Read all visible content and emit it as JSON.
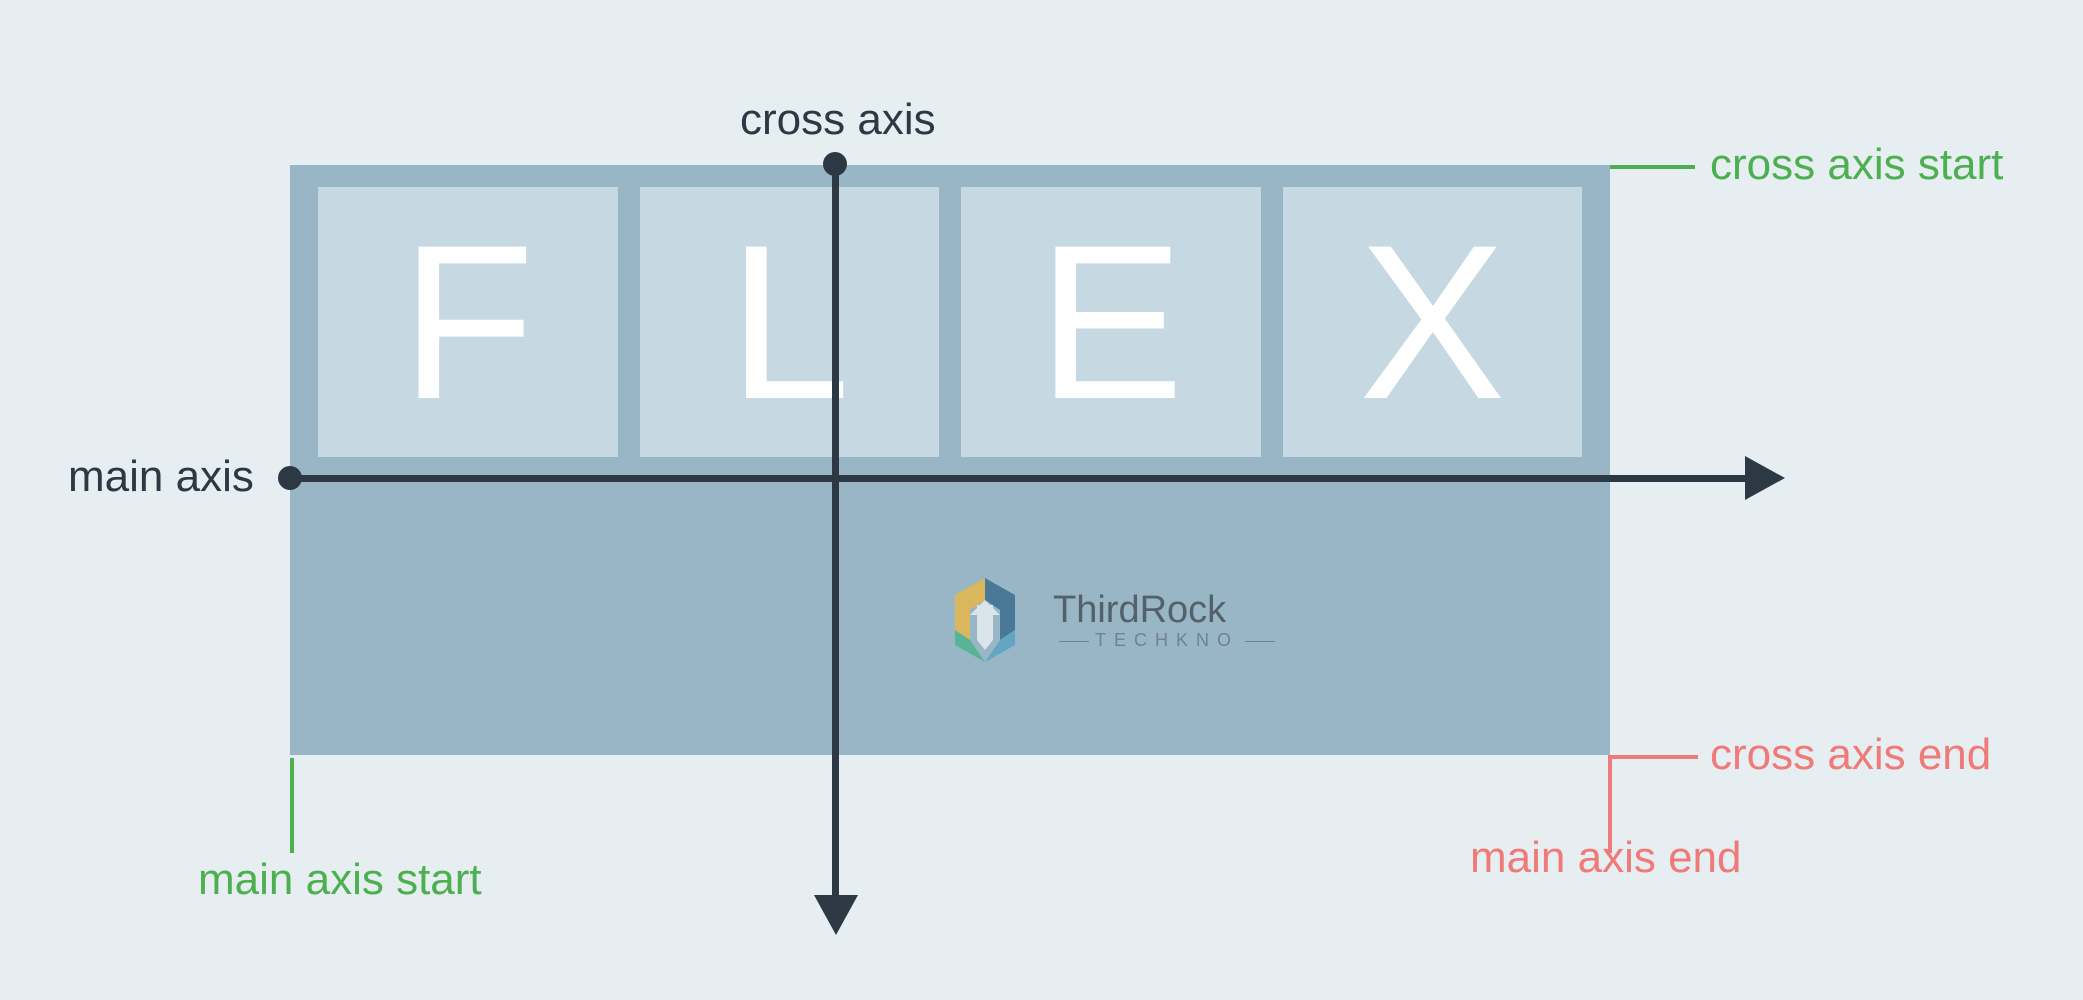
{
  "labels": {
    "cross_axis": "cross axis",
    "main_axis": "main axis",
    "cross_axis_start": "cross axis start",
    "cross_axis_end": "cross axis end",
    "main_axis_start": "main axis start",
    "main_axis_end": "main axis end"
  },
  "flex_items": [
    "F",
    "L",
    "E",
    "X"
  ],
  "logo": {
    "name": "ThirdRock",
    "sub": "TECHKNO"
  },
  "colors": {
    "bg": "#e6eef1",
    "container": "#98b6c5",
    "item": "#c6d9e2",
    "axis": "#2c3944",
    "green": "#4caf50",
    "red": "#ef7a78"
  }
}
